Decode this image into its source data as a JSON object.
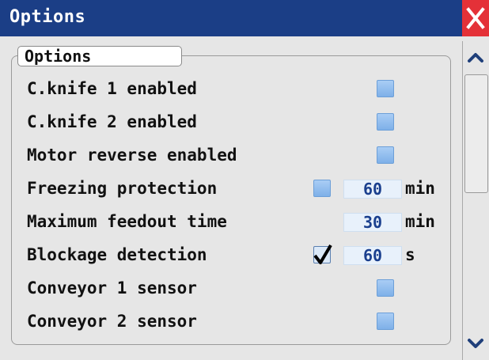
{
  "window": {
    "title": "Options"
  },
  "group": {
    "label": "Options"
  },
  "options": [
    {
      "label": "C.knife 1 enabled",
      "checked": false
    },
    {
      "label": "C.knife 2 enabled",
      "checked": false
    },
    {
      "label": "Motor reverse enabled",
      "checked": false
    },
    {
      "label": "Freezing protection",
      "checked": false,
      "value": "60",
      "unit": "min"
    },
    {
      "label": "Maximum feedout time",
      "value": "30",
      "unit": "min"
    },
    {
      "label": "Blockage detection",
      "checked": true,
      "value": "60",
      "unit": "s"
    },
    {
      "label": "Conveyor 1 sensor",
      "checked": false
    },
    {
      "label": "Conveyor 2 sensor",
      "checked": false
    }
  ],
  "colors": {
    "titlebar": "#1b3e86",
    "close": "#e43138",
    "checkbox": "#8ebdf0",
    "value_text": "#1a3f8e",
    "value_bg": "#e8f1fb"
  },
  "icons": {
    "close": "close-icon",
    "scroll_up": "chevron-up-icon",
    "scroll_down": "chevron-down-icon",
    "check": "checkmark-icon"
  }
}
